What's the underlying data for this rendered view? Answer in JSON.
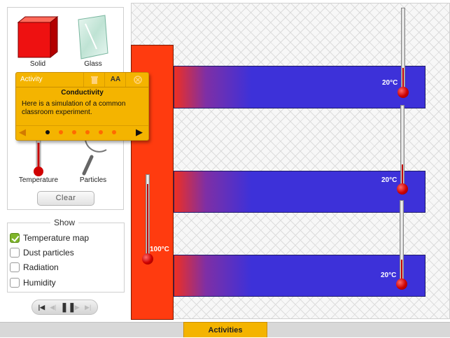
{
  "palette": {
    "items": [
      {
        "label": "Solid",
        "icon": "red-cube-icon"
      },
      {
        "label": "Glass",
        "icon": "glass-pane-icon"
      },
      {
        "label": "Temperature",
        "icon": "thermometer-icon"
      },
      {
        "label": "Particles",
        "icon": "magnifier-icon"
      }
    ],
    "clear_label": "Clear"
  },
  "show": {
    "title": "Show",
    "options": [
      {
        "label": "Temperature map",
        "checked": true
      },
      {
        "label": "Dust particles",
        "checked": false
      },
      {
        "label": "Radiation",
        "checked": false
      },
      {
        "label": "Humidity",
        "checked": false
      }
    ]
  },
  "activity_panel": {
    "tab_label": "Activity",
    "text_size_label": "AA",
    "title": "Conductivity",
    "body": "Here is a simulation of a common classroom experiment.",
    "page_count": 6,
    "current_page": 1,
    "icons": [
      "trash-icon",
      "text-size-icon",
      "close-icon",
      "prev-arrow-icon",
      "next-arrow-icon"
    ]
  },
  "simulation": {
    "heat_source_temp": "100°C",
    "bars": [
      {
        "temp": "20°C"
      },
      {
        "temp": "20°C"
      },
      {
        "temp": "20°C"
      }
    ],
    "colors": {
      "hot": "#ff3b0f",
      "cold": "#3d31d9"
    }
  },
  "playback": {
    "buttons": [
      "skip-back-icon",
      "step-back-icon",
      "pause-icon",
      "step-forward-icon",
      "skip-forward-icon"
    ]
  },
  "footer": {
    "activities_label": "Activities"
  }
}
